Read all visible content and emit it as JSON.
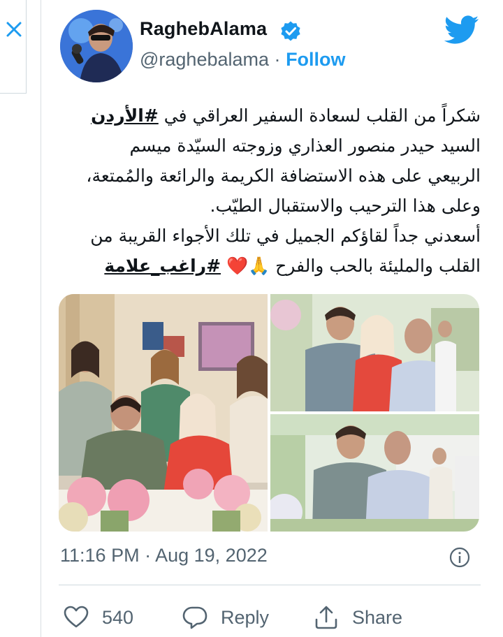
{
  "author": {
    "name": "RaghebAlama",
    "handle": "@raghebalama",
    "separator": "·",
    "follow_label": "Follow"
  },
  "tweet": {
    "lines": [
      {
        "text": "شكراً من القلب لسعادة السفير العراقي في ",
        "hashtag": "#الأردن"
      },
      {
        "text": "السيد حيدر منصور العذاري وزوجته السيّدة ميسم"
      },
      {
        "text": "الربيعي على هذه الاستضافة الكريمة والرائعة والمُمتعة،"
      },
      {
        "text": "وعلى هذا الترحيب والاستقبال الطيّب."
      },
      {
        "text": "أسعدني جداً لقاؤكم الجميل في تلك الأجواء القريبة من"
      },
      {
        "text": "القلب والمليئة بالحب والفرح 🙏❤️ ",
        "hashtag": "#راغب_علامة"
      }
    ]
  },
  "photos": [
    {
      "id": "photo-group-seated"
    },
    {
      "id": "photo-three-standing"
    },
    {
      "id": "photo-two-men"
    }
  ],
  "footer": {
    "time": "11:16 PM",
    "separator": "·",
    "date": "Aug 19, 2022"
  },
  "actions": {
    "like_count": "540",
    "reply_label": "Reply",
    "share_label": "Share"
  },
  "icons": {
    "close": "close-icon",
    "verified": "verified-badge-icon",
    "twitter": "twitter-bird-icon",
    "info": "info-icon",
    "like": "heart-icon",
    "reply": "reply-bubble-icon",
    "share": "share-icon"
  },
  "colors": {
    "accent": "#1d9bf0",
    "text": "#0f1419",
    "muted": "#536471",
    "border": "#cfd9de"
  }
}
